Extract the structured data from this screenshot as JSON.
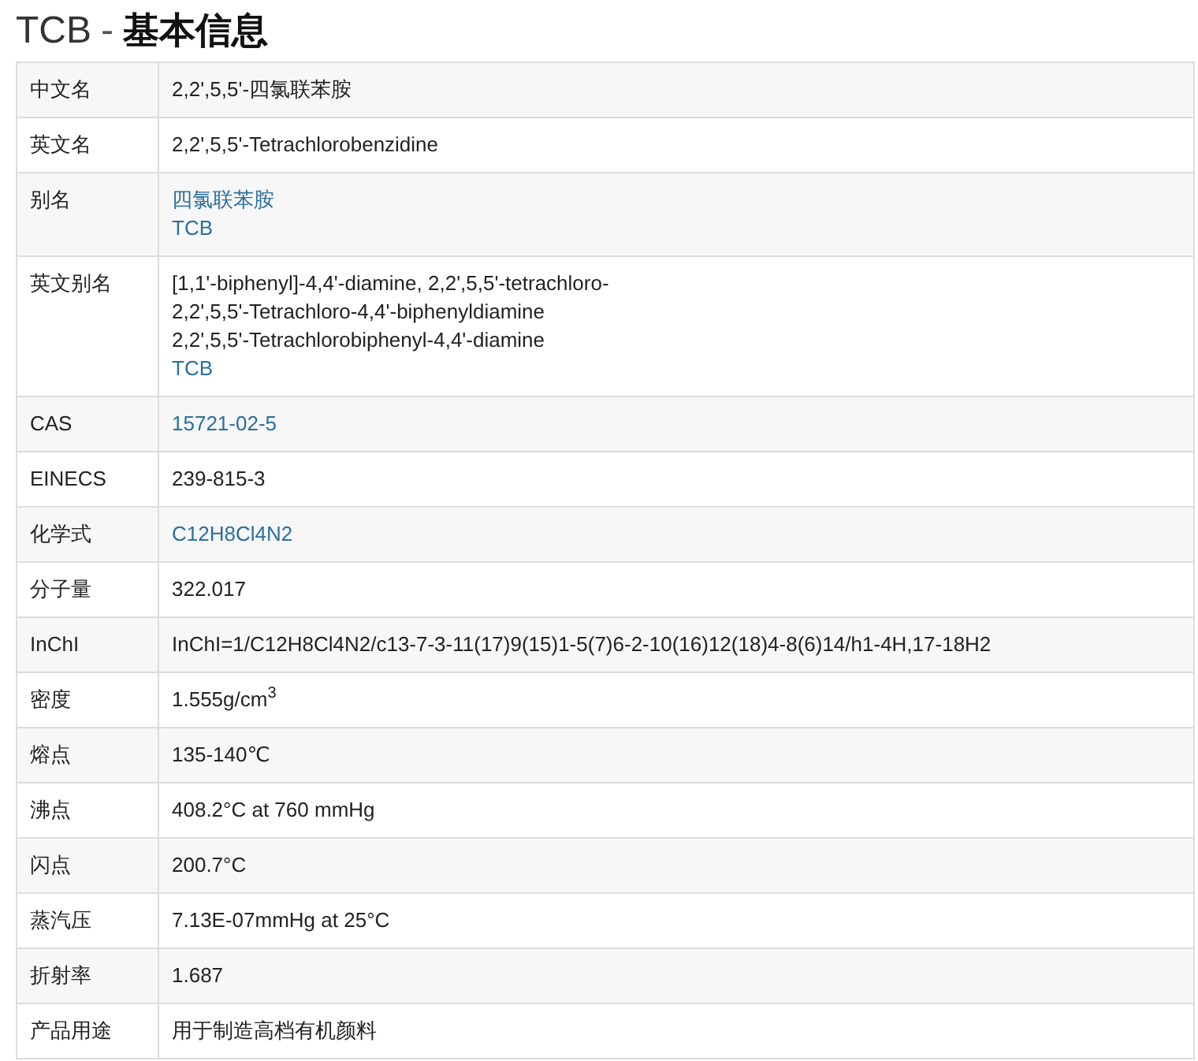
{
  "title": {
    "name": "TCB",
    "separator": "-",
    "section": "基本信息"
  },
  "rows": [
    {
      "label": "中文名",
      "values": [
        {
          "kind": "text",
          "text": "2,2',5,5'-四氯联苯胺"
        }
      ]
    },
    {
      "label": "英文名",
      "values": [
        {
          "kind": "text",
          "text": "2,2',5,5'-Tetrachlorobenzidine"
        }
      ]
    },
    {
      "label": "别名",
      "values": [
        {
          "kind": "link",
          "text": "四氯联苯胺"
        },
        {
          "kind": "link",
          "text": "TCB"
        }
      ]
    },
    {
      "label": "英文别名",
      "values": [
        {
          "kind": "text",
          "text": "[1,1'-biphenyl]-4,4'-diamine, 2,2',5,5'-tetrachloro-"
        },
        {
          "kind": "text",
          "text": "2,2',5,5'-Tetrachloro-4,4'-biphenyldiamine"
        },
        {
          "kind": "text",
          "text": "2,2',5,5'-Tetrachlorobiphenyl-4,4'-diamine"
        },
        {
          "kind": "link",
          "text": "TCB"
        }
      ]
    },
    {
      "label": "CAS",
      "values": [
        {
          "kind": "link",
          "text": "15721-02-5"
        }
      ]
    },
    {
      "label": "EINECS",
      "values": [
        {
          "kind": "text",
          "text": "239-815-3"
        }
      ]
    },
    {
      "label": "化学式",
      "values": [
        {
          "kind": "link",
          "text": "C12H8Cl4N2"
        }
      ]
    },
    {
      "label": "分子量",
      "values": [
        {
          "kind": "text",
          "text": "322.017"
        }
      ]
    },
    {
      "label": "InChI",
      "values": [
        {
          "kind": "text",
          "text": "InChI=1/C12H8Cl4N2/c13-7-3-11(17)9(15)1-5(7)6-2-10(16)12(18)4-8(6)14/h1-4H,17-18H2"
        }
      ]
    },
    {
      "label": "密度",
      "values": [
        {
          "kind": "text",
          "text": "1.555g/cm$^{3}$"
        }
      ]
    },
    {
      "label": "熔点",
      "values": [
        {
          "kind": "text",
          "text": "135-140℃"
        }
      ]
    },
    {
      "label": "沸点",
      "values": [
        {
          "kind": "text",
          "text": "408.2°C at 760 mmHg"
        }
      ]
    },
    {
      "label": "闪点",
      "values": [
        {
          "kind": "text",
          "text": "200.7°C"
        }
      ]
    },
    {
      "label": "蒸汽压",
      "values": [
        {
          "kind": "text",
          "text": "7.13E-07mmHg at 25°C"
        }
      ]
    },
    {
      "label": "折射率",
      "values": [
        {
          "kind": "text",
          "text": "1.687"
        }
      ]
    },
    {
      "label": "产品用途",
      "values": [
        {
          "kind": "text",
          "text": "用于制造高档有机颜料"
        }
      ]
    }
  ]
}
